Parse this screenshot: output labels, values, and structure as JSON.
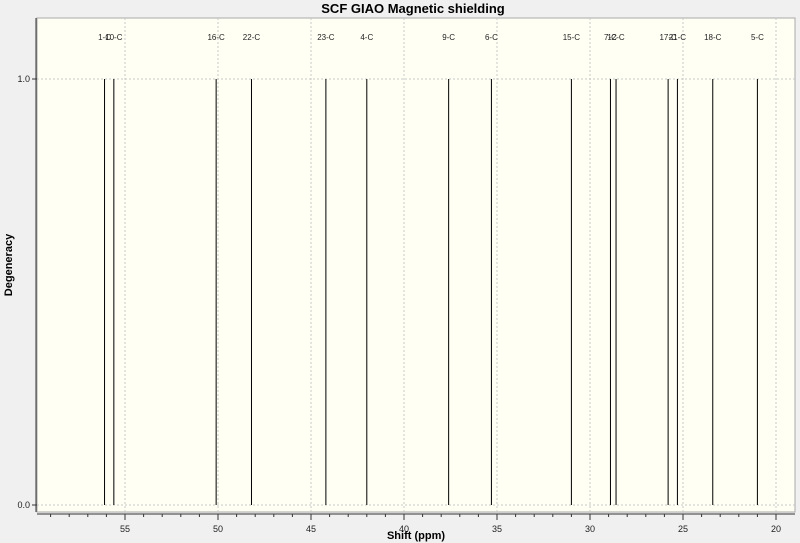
{
  "chart_data": {
    "type": "bar",
    "title": "SCF GIAO Magnetic shielding",
    "xlabel": "Shift (ppm)",
    "ylabel": "Degeneracy",
    "xlim": [
      59.7,
      19.1
    ],
    "x_reversed": true,
    "ylim": [
      0.0,
      1.0
    ],
    "xticks": [
      55,
      50,
      45,
      40,
      35,
      30,
      25,
      20
    ],
    "yticks": [
      "0.0",
      "1.0"
    ],
    "grid": true,
    "colors": {
      "plot_bg": "#fffff4",
      "frame_bg": "#f0f0f0",
      "line": "#000000"
    },
    "peaks": [
      {
        "label": "1-C",
        "shift": 56.1,
        "degeneracy": 1
      },
      {
        "label": "10-C",
        "shift": 55.6,
        "degeneracy": 1
      },
      {
        "label": "16-C",
        "shift": 50.1,
        "degeneracy": 1
      },
      {
        "label": "22-C",
        "shift": 48.2,
        "degeneracy": 1
      },
      {
        "label": "23-C",
        "shift": 44.2,
        "degeneracy": 1
      },
      {
        "label": "4-C",
        "shift": 42.0,
        "degeneracy": 1
      },
      {
        "label": "9-C",
        "shift": 37.6,
        "degeneracy": 1
      },
      {
        "label": "6-C",
        "shift": 35.3,
        "degeneracy": 1
      },
      {
        "label": "15-C",
        "shift": 31.0,
        "degeneracy": 1
      },
      {
        "label": "7-C",
        "shift": 28.9,
        "degeneracy": 1
      },
      {
        "label": "12-C",
        "shift": 28.6,
        "degeneracy": 1
      },
      {
        "label": "17-C",
        "shift": 25.8,
        "degeneracy": 1
      },
      {
        "label": "21-C",
        "shift": 25.3,
        "degeneracy": 1
      },
      {
        "label": "18-C",
        "shift": 23.4,
        "degeneracy": 1
      },
      {
        "label": "5-C",
        "shift": 21.0,
        "degeneracy": 1
      }
    ]
  }
}
